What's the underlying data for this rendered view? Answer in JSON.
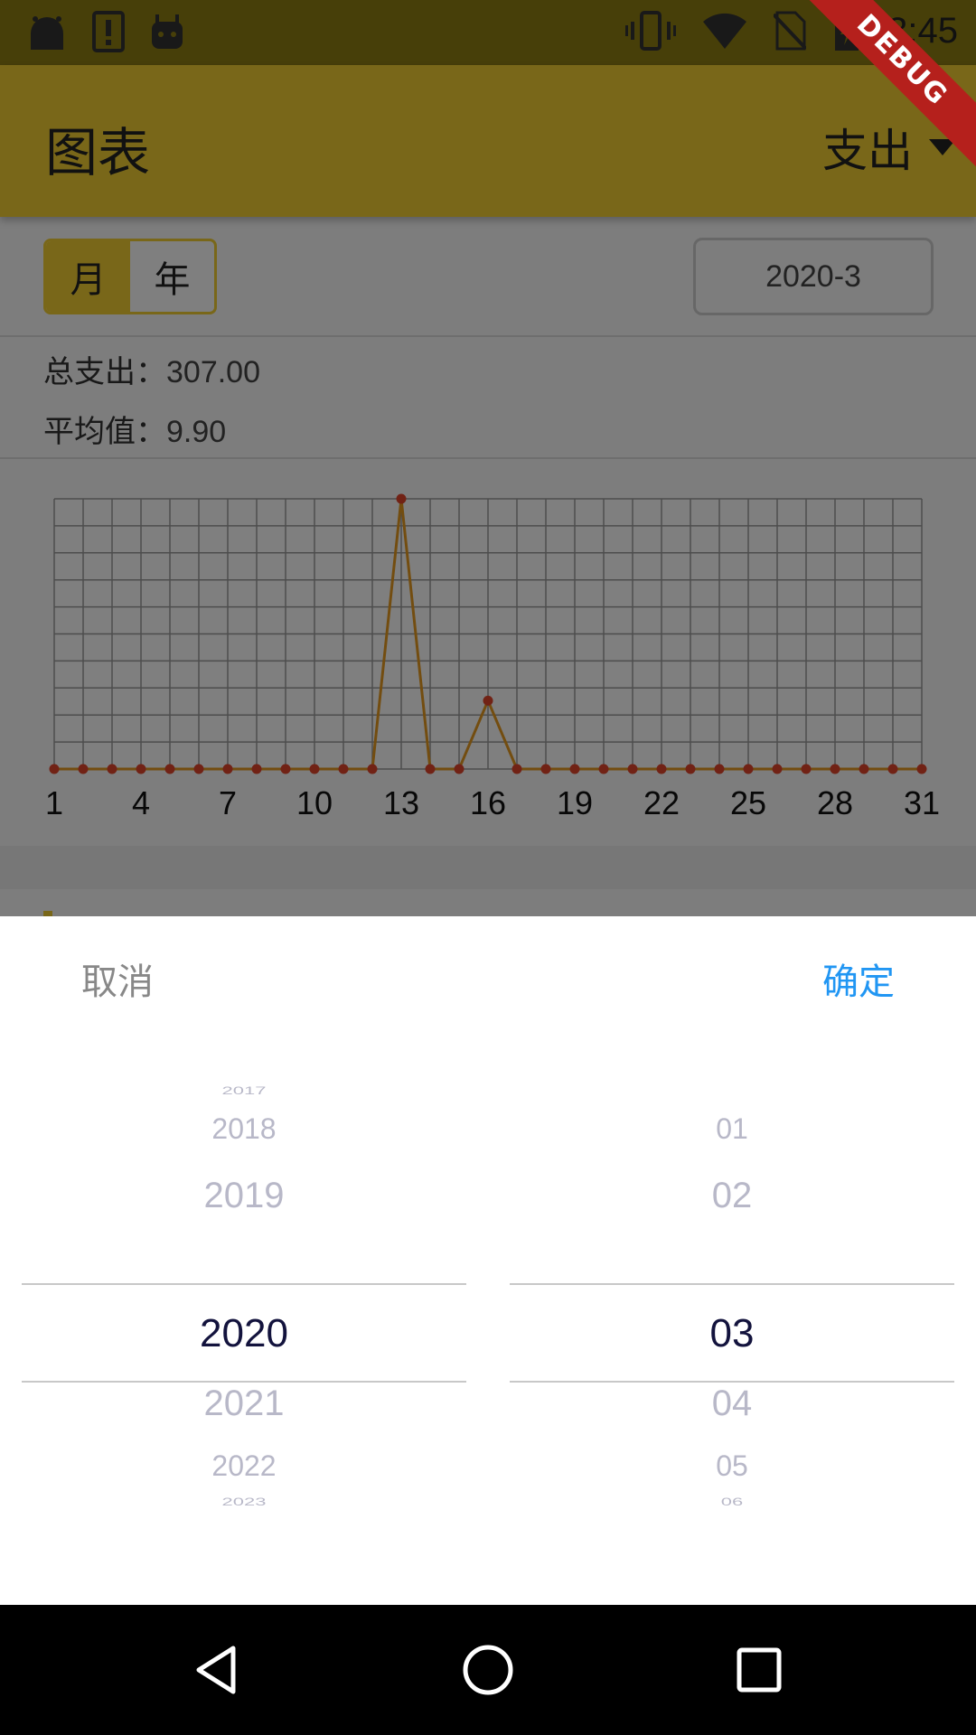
{
  "status_bar": {
    "time": "3:45"
  },
  "app_bar": {
    "title": "图表",
    "type_selector": "支出",
    "debug_label": "DEBUG"
  },
  "period_toggle": {
    "month": "月",
    "year": "年",
    "selected": "月"
  },
  "date_field": {
    "value": "2020-3"
  },
  "summary": {
    "total_label": "总支出：",
    "total_value": "307.00",
    "avg_label": "平均值：",
    "avg_value": "9.90"
  },
  "chart_data": {
    "type": "line",
    "x": [
      1,
      2,
      3,
      4,
      5,
      6,
      7,
      8,
      9,
      10,
      11,
      12,
      13,
      14,
      15,
      16,
      17,
      18,
      19,
      20,
      21,
      22,
      23,
      24,
      25,
      26,
      27,
      28,
      29,
      30,
      31
    ],
    "tick_labels": [
      "1",
      "4",
      "7",
      "10",
      "13",
      "16",
      "19",
      "22",
      "25",
      "28",
      "31"
    ],
    "series": [
      {
        "values": [
          0,
          0,
          0,
          0,
          0,
          0,
          0,
          0,
          0,
          0,
          0,
          0,
          245,
          0,
          0,
          62,
          0,
          0,
          0,
          0,
          0,
          0,
          0,
          0,
          0,
          0,
          0,
          0,
          0,
          0,
          0
        ]
      }
    ],
    "ylim": [
      0,
      245
    ],
    "grid": true,
    "line_color": "#e69a20",
    "point_color": "#e2452b"
  },
  "picker": {
    "cancel": "取消",
    "confirm": "确定",
    "years": [
      "2017",
      "2018",
      "2019",
      "2020",
      "2021",
      "2022",
      "2023"
    ],
    "months": [
      "01",
      "02",
      "03",
      "04",
      "05",
      "06"
    ],
    "selected_year_index": 3,
    "selected_month_index": 2
  },
  "colors": {
    "accent": "#f2cf33",
    "confirm": "#2196f3",
    "selected_text": "#13133d"
  }
}
